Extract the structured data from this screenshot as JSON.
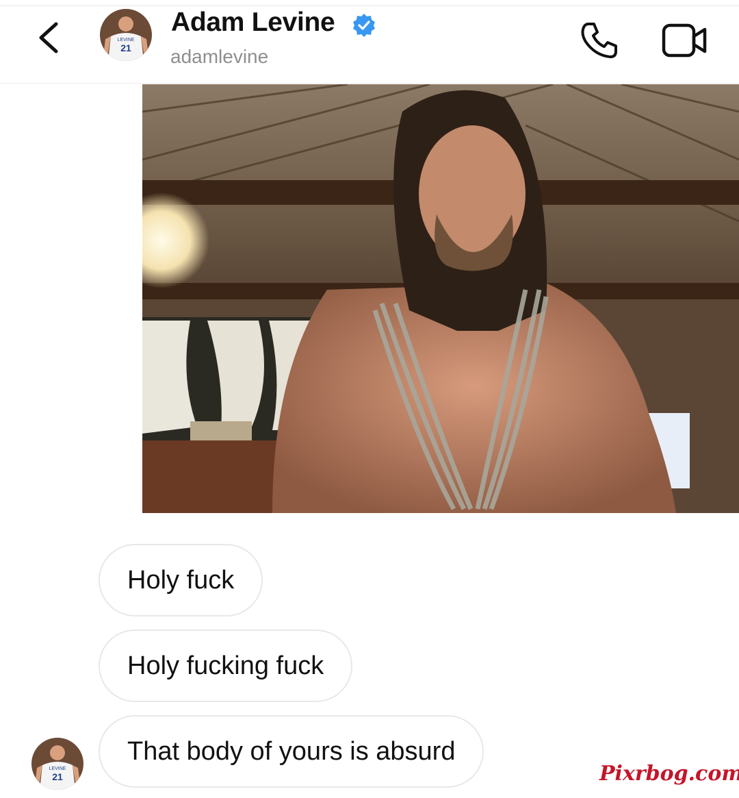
{
  "header": {
    "title": "Adam Levine",
    "username": "adamlevine",
    "avatar_jersey_name": "LEVINE",
    "avatar_jersey_number": "21",
    "back_icon": "chevron-left-icon",
    "verified_icon": "verified-badge-icon",
    "call_icon": "phone-icon",
    "video_icon": "video-camera-icon"
  },
  "messages": [
    {
      "type": "photo"
    },
    {
      "type": "text",
      "text": "Holy fuck"
    },
    {
      "type": "text",
      "text": "Holy fucking fuck"
    },
    {
      "type": "text",
      "text": "That body of yours is absurd"
    }
  ],
  "watermark": "Pixrbog.com",
  "colors": {
    "verified_blue": "#3897f0",
    "watermark_red": "#c4152a",
    "bubble_border": "#e8e8e8",
    "username_gray": "#8e8e8e"
  }
}
